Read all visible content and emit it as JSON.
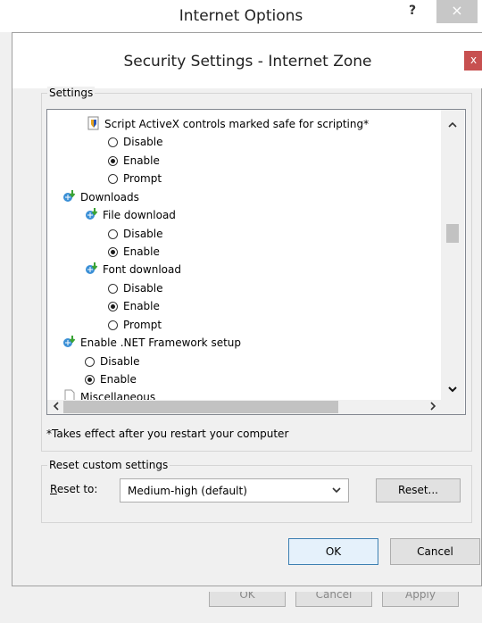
{
  "outer": {
    "title": "Internet Options",
    "help_label": "?",
    "close_label": "×",
    "buttons": [
      "OK",
      "Cancel",
      "Apply"
    ]
  },
  "dialog": {
    "title": "Security Settings - Internet Zone",
    "close_label": "x",
    "settings_group_label": "Settings",
    "tree": [
      {
        "type": "header",
        "label": "Script ActiveX controls marked safe for scripting*"
      },
      {
        "type": "option",
        "label": "Disable",
        "checked": false
      },
      {
        "type": "option",
        "label": "Enable",
        "checked": true
      },
      {
        "type": "option",
        "label": "Prompt",
        "checked": false
      },
      {
        "type": "header",
        "label": "Downloads"
      },
      {
        "type": "header",
        "label": "File download"
      },
      {
        "type": "option",
        "label": "Disable",
        "checked": false
      },
      {
        "type": "option",
        "label": "Enable",
        "checked": true
      },
      {
        "type": "header",
        "label": "Font download"
      },
      {
        "type": "option",
        "label": "Disable",
        "checked": false
      },
      {
        "type": "option",
        "label": "Enable",
        "checked": true
      },
      {
        "type": "option",
        "label": "Prompt",
        "checked": false
      },
      {
        "type": "header",
        "label": "Enable .NET Framework setup"
      },
      {
        "type": "option",
        "label": "Disable",
        "checked": false
      },
      {
        "type": "option",
        "label": "Enable",
        "checked": true
      },
      {
        "type": "header",
        "label": "Miscellaneous"
      }
    ],
    "restart_note": "*Takes effect after you restart your computer",
    "reset_group_label": "Reset custom settings",
    "reset_to_label": "Reset to:",
    "reset_select_value": "Medium-high (default)",
    "reset_button_label": "Reset...",
    "ok_label": "OK",
    "cancel_label": "Cancel"
  },
  "icons": {
    "shield": "shield-icon",
    "download": "download-icon",
    "doc": "document-icon"
  }
}
